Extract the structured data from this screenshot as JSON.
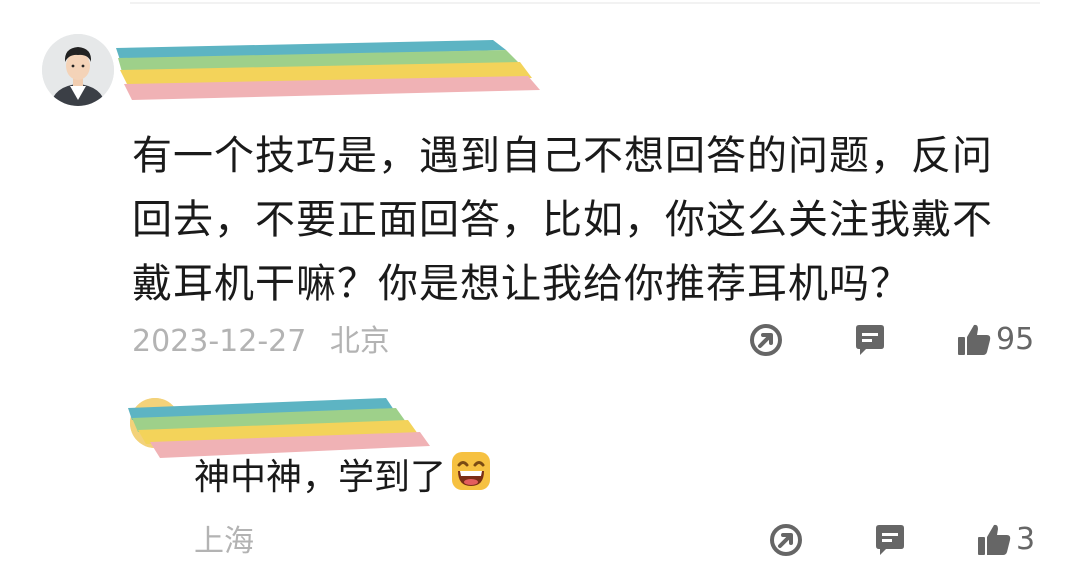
{
  "comment": {
    "text": "有一个技巧是，遇到自己不想回答的问题，反问回去，不要正面回答，比如，你这么关注我戴不戴耳机干嘛？你是想让我给你推荐耳机吗？",
    "date": "2023-12-27",
    "location": "北京",
    "like_count": "95",
    "icons": [
      "share-icon",
      "comment-icon",
      "thumbs-up-icon"
    ]
  },
  "reply": {
    "text": "神中神，学到了",
    "emoji": "grinning-face-emoji",
    "location": "上海",
    "like_count": "3",
    "icons": [
      "share-icon",
      "comment-icon",
      "thumbs-up-icon"
    ]
  },
  "colors": {
    "rainbow_blue": "#5db4c3",
    "rainbow_green": "#9ed08a",
    "rainbow_yellow": "#f3d35a",
    "rainbow_pink": "#f0b2b5",
    "meta_gray": "#b3b3b3",
    "icon_gray": "#666666"
  }
}
